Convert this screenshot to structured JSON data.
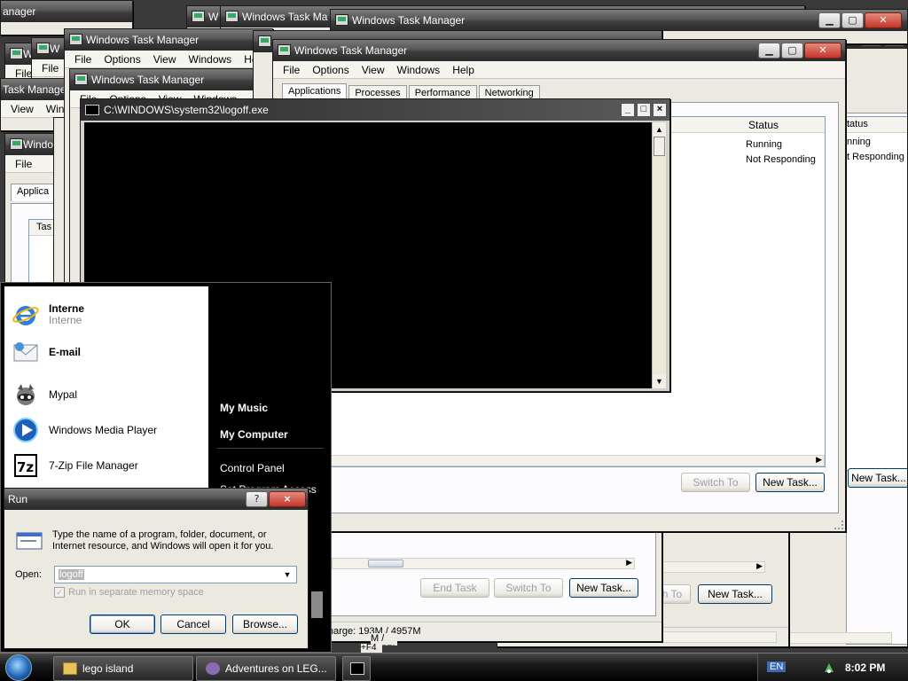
{
  "task_manager": {
    "title": "Windows Task Manager",
    "title_clipped": "Windows Task Ma",
    "title_fragment": "Windows T",
    "title_tiny": "Windo",
    "title_tiny2": "W",
    "title_left_clipped": "Task Manager",
    "title_partial": "anager",
    "menu": {
      "file": "File",
      "options": "Options",
      "view": "View",
      "windows": "Windows",
      "windows_clipped": "Wind",
      "windows_frag": "Win",
      "help": "Help",
      "help_clipped": "Help"
    },
    "tabs": {
      "applications": "Applications",
      "applications_clipped": "Applica",
      "processes": "Processes",
      "performance": "Performance",
      "networking": "Networking"
    },
    "columns": {
      "task_fragment": "Tas",
      "status": "Status",
      "status_clipped": "tatus"
    },
    "rows": [
      {
        "status": "Running",
        "status_clipped": "nning"
      },
      {
        "status": "Not Responding",
        "status_clipped": "t Responding"
      }
    ],
    "buttons": {
      "end_task": "End Task",
      "switch_to": "Switch To",
      "switch_to_clipped": "h To",
      "new_task": "New Task..."
    },
    "status": {
      "commit": "harge: 193M / 4957M",
      "commit_clipped": "M / 4957M",
      "keys": "+F4"
    }
  },
  "console": {
    "title": "C:\\WINDOWS\\system32\\logoff.exe",
    "buttons": {
      "minimize": "_",
      "maximize": "□",
      "close": "×"
    }
  },
  "start_menu": {
    "left_items": [
      {
        "label": "Interne",
        "sublabel": "Interne",
        "icon": "internet-explorer-icon"
      },
      {
        "label": "E-mail",
        "icon": "email-icon"
      },
      {
        "label": "Mypal",
        "icon": "mypal-icon"
      },
      {
        "label": "Windows Media Player",
        "icon": "media-player-icon"
      },
      {
        "label": "7-Zip File Manager",
        "icon": "7zip-icon"
      }
    ],
    "right_items": {
      "my_music": "My Music",
      "my_computer": "My Computer",
      "control_panel": "Control Panel",
      "set_program_access": "Set Program Access"
    }
  },
  "run_dialog": {
    "title": "Run",
    "help_button": "?",
    "close_button": "×",
    "description": "Type the name of a program, folder, document, or Internet resource, and Windows will open it for you.",
    "open_label": "Open:",
    "open_value": "logoff",
    "separate_memory": "Run in separate memory space",
    "ok": "OK",
    "cancel": "Cancel",
    "browse": "Browse..."
  },
  "taskbar": {
    "items": [
      {
        "label": "lego island"
      },
      {
        "label": "Adventures on LEG..."
      }
    ],
    "language": "EN",
    "clock": "8:02 PM"
  }
}
